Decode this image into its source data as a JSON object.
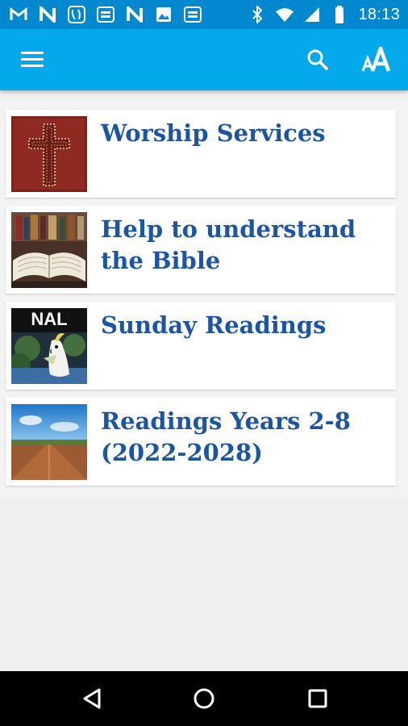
{
  "status_bar": {
    "time": "18:13",
    "notification_icons": [
      "gmail-icon",
      "n-app-icon",
      "shoe-app-icon",
      "bible-app-icon",
      "n-app-icon",
      "image-icon",
      "bible-app-icon"
    ],
    "system_icons": [
      "bluetooth-icon",
      "wifi-icon",
      "battery-icon"
    ]
  },
  "app_bar": {
    "menu_icon": "hamburger-menu-icon",
    "actions": [
      "search-icon",
      "text-size-icon"
    ],
    "color": "#04a9ec"
  },
  "items": [
    {
      "title": "Worship Services",
      "thumbnail": "cross-image"
    },
    {
      "title": "Help to understand the Bible",
      "thumbnail": "open-bible-image"
    },
    {
      "title": "Sunday Readings",
      "thumbnail": "nal-cockatoo-image",
      "thumbnail_label": "NAL"
    },
    {
      "title": "Readings Years 2-8 (2022-2028)",
      "thumbnail": "outback-road-image"
    }
  ],
  "navigation_bar": {
    "buttons": [
      "back-icon",
      "home-icon",
      "recents-icon"
    ]
  },
  "colors": {
    "status_bar": "#0288cf",
    "app_bar": "#04a9ec",
    "title_text": "#1d55a5",
    "background": "#efefef"
  }
}
